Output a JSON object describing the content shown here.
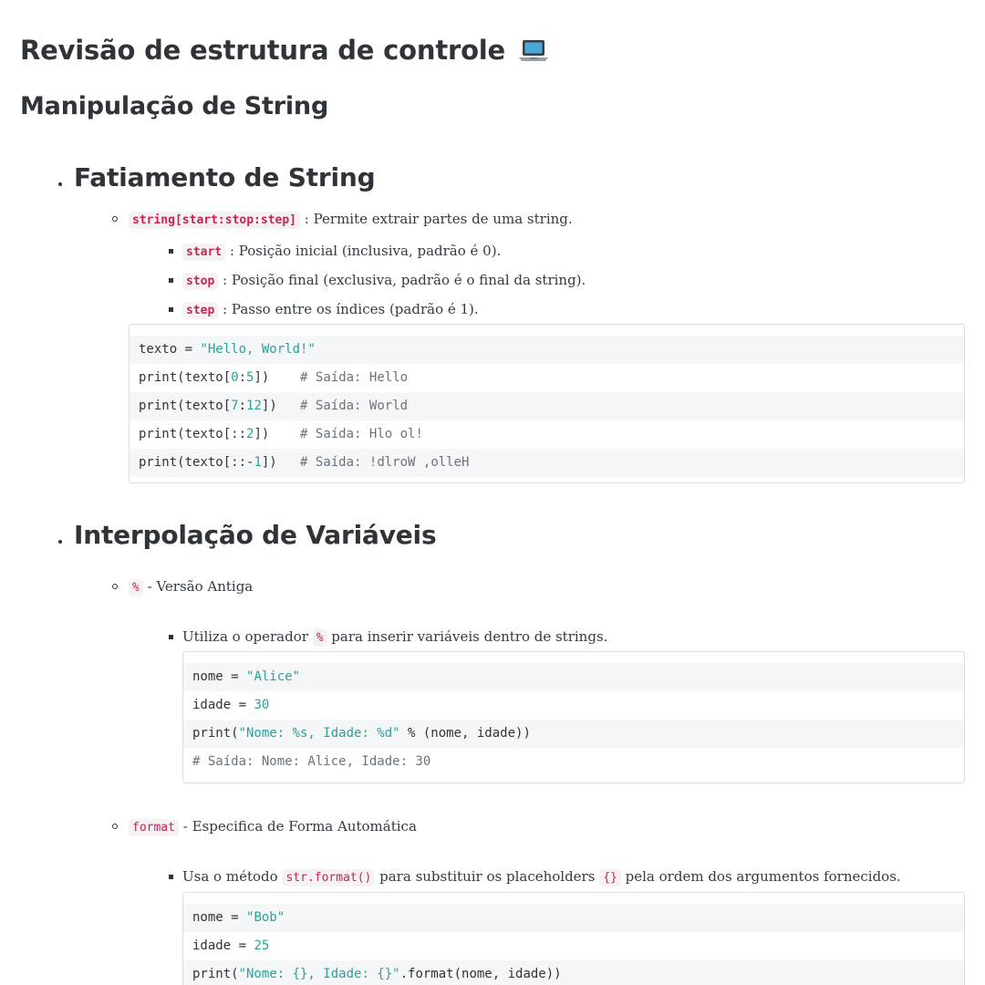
{
  "title": "Revisão de estrutura de controle",
  "subtitle": "Manipulação de String",
  "sections": {
    "slicing": {
      "heading": "Fatiamento de String",
      "syntax": "string[start:stop:step]",
      "syntax_desc": ": Permite extrair partes de uma string.",
      "params": [
        {
          "name": "start",
          "desc": ": Posição inicial (inclusiva, padrão é 0)."
        },
        {
          "name": "stop",
          "desc": ": Posição final (exclusiva, padrão é o final da string)."
        },
        {
          "name": "step",
          "desc": ": Passo entre os índices (padrão é 1)."
        }
      ],
      "code": {
        "l1a": "texto = ",
        "l1b": "\"Hello, World!\"",
        "l2a": "print(texto[",
        "l2b": "0",
        "l2c": ":",
        "l2d": "5",
        "l2e": "])    ",
        "l2f": "# Saída: Hello",
        "l3a": "print(texto[",
        "l3b": "7",
        "l3c": ":",
        "l3d": "12",
        "l3e": "])   ",
        "l3f": "# Saída: World",
        "l4a": "print(texto[::",
        "l4b": "2",
        "l4c": "])    ",
        "l4d": "# Saída: Hlo ol!",
        "l5a": "print(texto[::-",
        "l5b": "1",
        "l5c": "])   ",
        "l5d": "# Saída: !dlroW ,olleH"
      }
    },
    "interp": {
      "heading": "Interpolação de Variáveis",
      "percent": {
        "op": "%",
        "label": "- Versão Antiga",
        "desc_a": "Utiliza o operador",
        "desc_op": "%",
        "desc_b": "para inserir variáveis dentro de strings.",
        "code": {
          "l1a": "nome = ",
          "l1b": "\"Alice\"",
          "l2a": "idade = ",
          "l2b": "30",
          "l3a": "print(",
          "l3b": "\"Nome: %s, Idade: %d\"",
          "l3c": " % (nome, idade))",
          "l4": "# Saída: Nome: Alice, Idade: 30"
        }
      },
      "format": {
        "op": "format",
        "label": "- Especifica de Forma Automática",
        "desc_a": "Usa o método",
        "desc_code": "str.format()",
        "desc_b": "para substituir os placeholders",
        "desc_code2": "{}",
        "desc_c": "pela ordem dos argumentos fornecidos.",
        "code": {
          "l1a": "nome = ",
          "l1b": "\"Bob\"",
          "l2a": "idade = ",
          "l2b": "25",
          "l3a": "print(",
          "l3b": "\"Nome: {}, Idade: {}\"",
          "l3c": ".format(nome, idade))"
        }
      }
    }
  }
}
